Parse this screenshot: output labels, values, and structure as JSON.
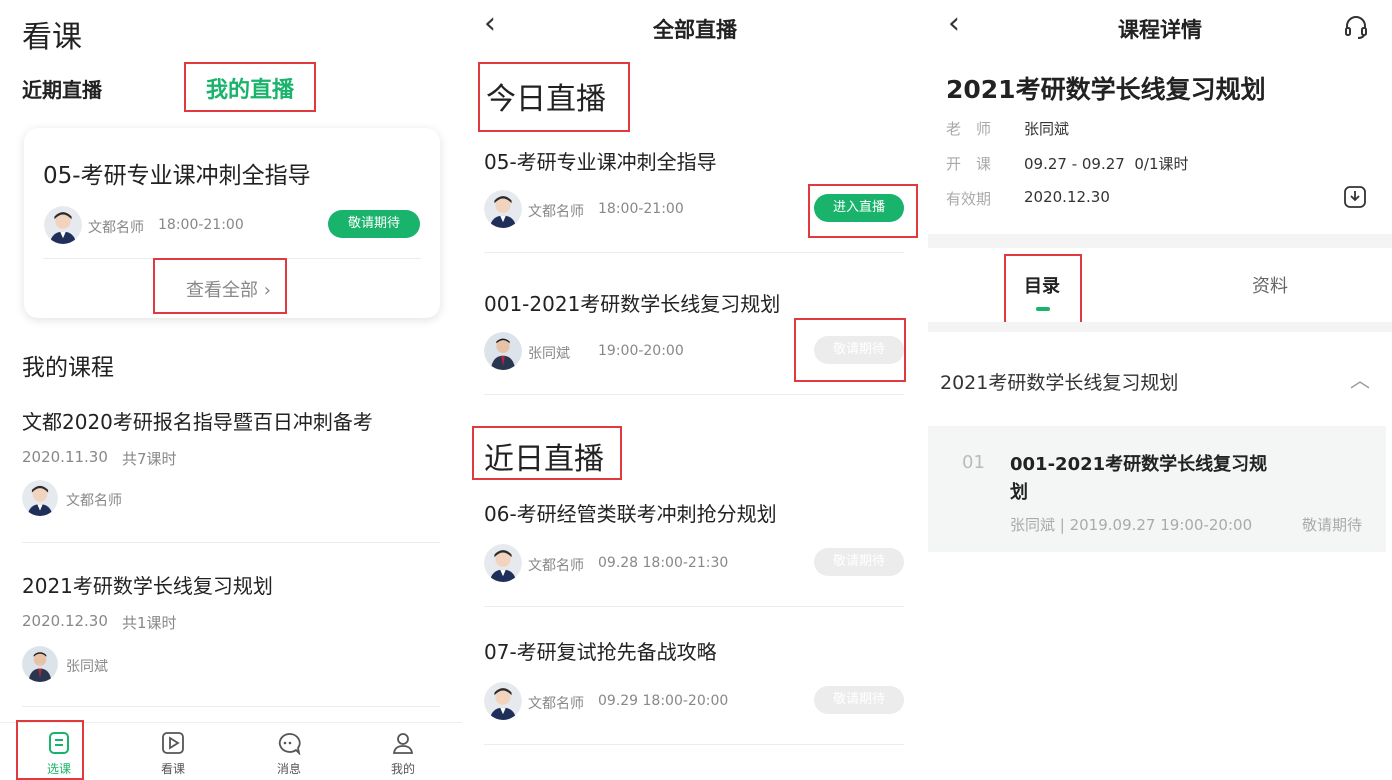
{
  "panel1": {
    "title": "看课",
    "recent_live_label": "近期直播",
    "my_live_label": "我的直播",
    "live_card": {
      "course_title": "05-考研专业课冲刺全指导",
      "teacher": "文都名师",
      "time": "18:00-21:00",
      "status": "敬请期待",
      "view_all": "查看全部"
    },
    "my_courses_label": "我的课程",
    "courses": [
      {
        "title": "文都2020考研报名指导暨百日冲刺备考",
        "date": "2020.11.30",
        "lessons": "共7课时",
        "teacher": "文都名师"
      },
      {
        "title": "2021考研数学长线复习规划",
        "date": "2020.12.30",
        "lessons": "共1课时",
        "teacher": "张同斌"
      }
    ],
    "tabbar": [
      {
        "label": "选课",
        "icon": "course-select-icon"
      },
      {
        "label": "看课",
        "icon": "play-video-icon"
      },
      {
        "label": "消息",
        "icon": "message-icon"
      },
      {
        "label": "我的",
        "icon": "profile-icon"
      }
    ]
  },
  "panel2": {
    "back_icon": "back-arrow-icon",
    "title": "全部直播",
    "today_label": "今日直播",
    "recent_label": "近日直播",
    "today_items": [
      {
        "title": "05-考研专业课冲刺全指导",
        "teacher": "文都名师",
        "time": "18:00-21:00",
        "action": "进入直播"
      },
      {
        "title": "001-2021考研数学长线复习规划",
        "teacher": "张同斌",
        "time": "19:00-20:00",
        "action": "敬请期待"
      }
    ],
    "recent_items": [
      {
        "title": "06-考研经管类联考冲刺抢分规划",
        "teacher": "文都名师",
        "time": "09.28 18:00-21:30",
        "action": "敬请期待"
      },
      {
        "title": "07-考研复试抢先备战攻略",
        "teacher": "文都名师",
        "time": "09.29 18:00-20:00",
        "action": "敬请期待"
      }
    ]
  },
  "panel3": {
    "back_icon": "back-arrow-icon",
    "title": "课程详情",
    "headset_icon": "headset-icon",
    "course_title": "2021考研数学长线复习规划",
    "teacher_label": "老　师",
    "teacher": "张同斌",
    "start_label": "开　课",
    "start_value": "09.27 - 09.27  0/1课时",
    "valid_label": "有效期",
    "valid_value": "2020.12.30",
    "download_icon": "download-icon",
    "tabs": [
      "目录",
      "资料"
    ],
    "section_title": "2021考研数学长线复习规划",
    "lesson": {
      "index": "01",
      "title_line1": "001-2021考研数学长线复习规",
      "title_line2": "划",
      "meta": "张同斌 | 2019.09.27 19:00-20:00",
      "status": "敬请期待"
    }
  }
}
